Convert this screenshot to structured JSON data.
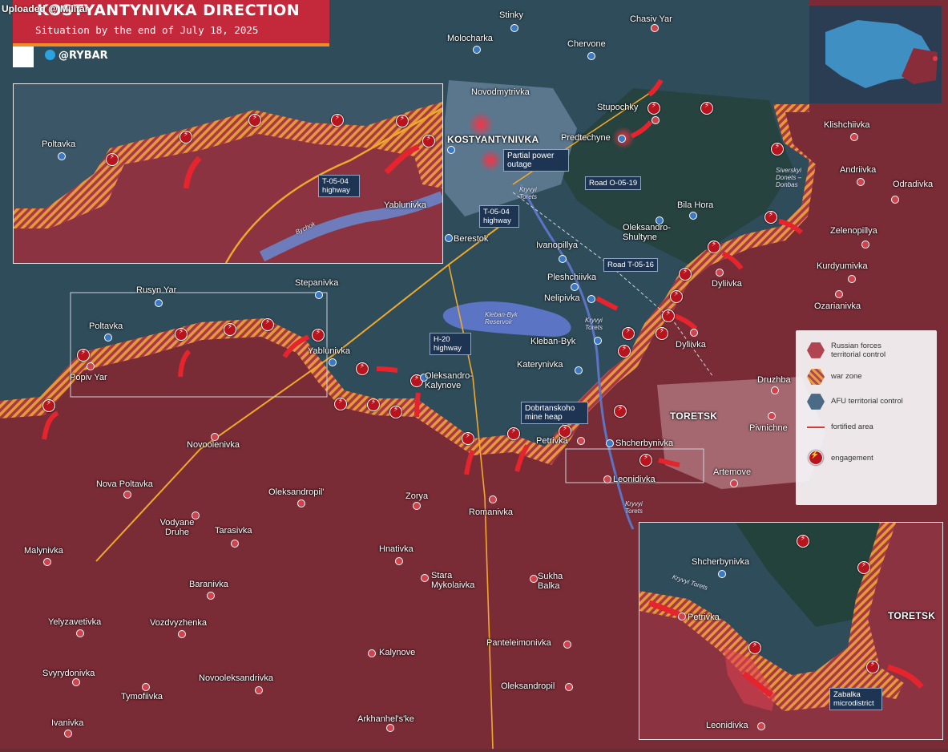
{
  "header": {
    "title": "KOSTYANTYNIVKA DIRECTION",
    "subtitle": "Situation by the end of July 18, 2025",
    "brand": "@RYBAR",
    "upload_tag": "Uploaded @ Militar"
  },
  "legend": {
    "items": [
      {
        "label": "Russian forces territorial control",
        "color": "#b04450"
      },
      {
        "label": "war zone",
        "color": "#e3a040"
      },
      {
        "label": "AFU territorial control",
        "color": "#4a6a86"
      },
      {
        "label": "fortified area",
        "color": "#d33a3a"
      },
      {
        "label": "engagement",
        "color": "#b8141e"
      }
    ]
  },
  "roads": {
    "t0504_main": "T-05-04 highway",
    "t0504_inset": "T-05-04 highway",
    "o0519": "Road O-05-19",
    "t0516": "Road T-05-16",
    "h20": "H-20 highway"
  },
  "callouts": {
    "power": "Partial power outage",
    "mine": "Dobrtanskoho mine heap",
    "zabalka": "Zabalka microdistrict"
  },
  "rivers": {
    "kryvyi1": "Kryvyi Torets",
    "kryvyi2": "Kryvyi Torets",
    "kryvyi3": "Kryvyi Torets",
    "kryvyi_inset": "Kryvyi Torets",
    "canal": "Siverskyi Donets – Donbas",
    "reservoir": "Kleban-Byk Reservoir",
    "bychok": "Bychok"
  },
  "places": {
    "kostyantynivka": "KOSTYANTYNIVKA",
    "toretsk": "TORETSK",
    "toretsk_inset": "TORETSK",
    "chasiv_yar": "Chasiv Yar",
    "stinky": "Stinky",
    "molocharka": "Molocharka",
    "chervone": "Chervone",
    "novodmytrivka": "Novodmytrivka",
    "stupochky": "Stupochky",
    "predtechyne": "Predtechyne",
    "klishchiivka": "Klishchiivka",
    "andriivka": "Andriivka",
    "odradivka": "Odradivka",
    "bila_hora": "Bila Hora",
    "zelenopillya": "Zelenopillya",
    "kurdyumivka": "Kurdyumivka",
    "oleksandro_shultyne": "Oleksandro-Shultyne",
    "berestok": "Berestok",
    "ivanopillya": "Ivanopillya",
    "pleshchiivka": "Pleshchiivka",
    "nelipivka": "Nelipivka",
    "dyliivka1": "Dyliivka",
    "dyliivka2": "Dyliivka",
    "ozarianivka": "Ozarianivka",
    "kleban_byk": "Kleban-Byk",
    "katerynivka": "Katerynivka",
    "druzhba": "Druzhba",
    "pivnichne": "Pivnichne",
    "rusyn_yar": "Rusyn Yar",
    "stepanivka": "Stepanivka",
    "poltavka": "Poltavka",
    "poltavka_inset": "Poltavka",
    "yablunivka": "Yablunivka",
    "yablunivka_inset": "Yablunivka",
    "popiv_yar": "Popiv Yar",
    "oleksandro_kalynove": "Oleksandro-Kalynove",
    "petrivka": "Petrivka",
    "petrivka_inset": "Petrivka",
    "shcherbynivka": "Shcherbynivka",
    "shcherbynivka_inset": "Shcherbynivka",
    "leonidivka": "Leonidivka",
    "leonidivka_inset": "Leonidivka",
    "artemove": "Artemove",
    "novoolenivka": "Novoolenivka",
    "nova_poltavka": "Nova Poltavka",
    "oleksandropil1": "Oleksandropil'",
    "zorya": "Zorya",
    "romanivka": "Romanivka",
    "vodyane_druhe": "Vodyane Druhe",
    "tarasivka": "Tarasivka",
    "malynivka": "Malynivka",
    "hnativka": "Hnatіvka",
    "stara_mykolaivka": "Stara Mykolaivka",
    "sukha_balka": "Sukha Balka",
    "baranivka": "Baranivka",
    "yelyzavetivka": "Yelyzavetivka",
    "vozdvyzhenka": "Vozdvyzhenka",
    "panteleimonivka": "Panteleimonivka",
    "svyrydonivka": "Svyrydonivka",
    "kalynove": "Kalynove",
    "novooleksandrivka": "Novooleksandrivka",
    "tymofiivka": "Tymofiivka",
    "oleksandropil2": "Oleksandropil",
    "arkhanhelske": "Arkhanhel's'ke",
    "ivanivka": "Ivanivka"
  }
}
